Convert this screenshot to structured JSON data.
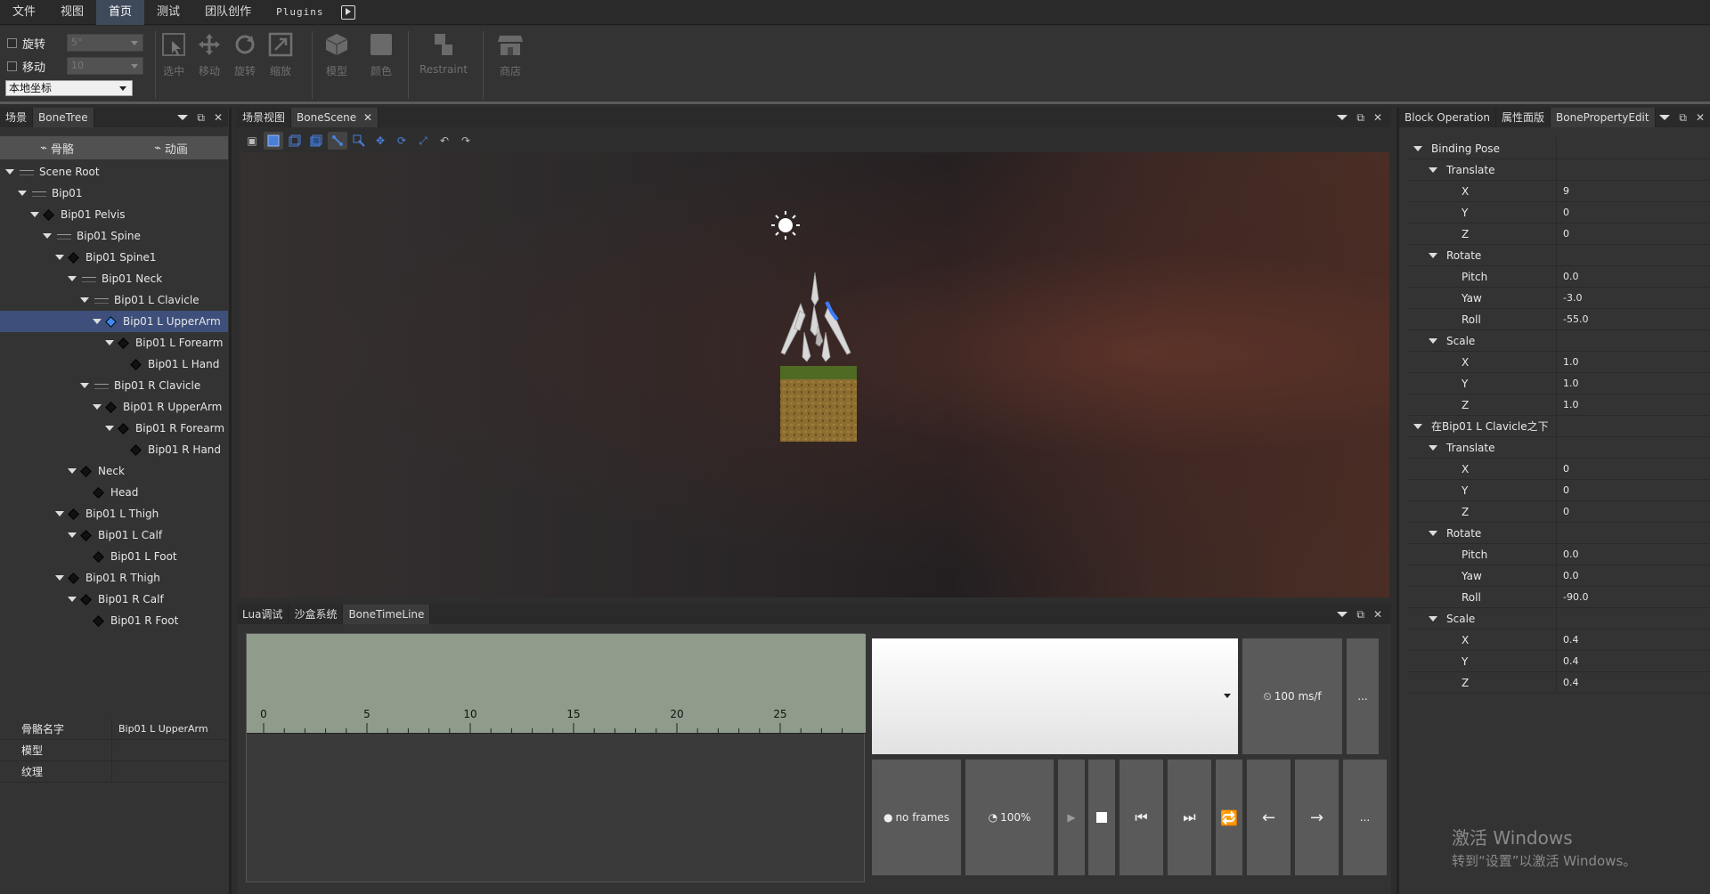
{
  "menu": [
    "文件",
    "视图",
    "首页",
    "测试",
    "团队创作",
    "Plugins"
  ],
  "toolbar": {
    "rotate_label": "旋转",
    "rotate_value": "5°",
    "move_label": "移动",
    "move_value": "10",
    "coord_value": "本地坐标",
    "buttons": [
      "选中",
      "移动",
      "旋转",
      "缩放",
      "模型",
      "颜色",
      "Restraint",
      "商店"
    ]
  },
  "left": {
    "tabs": [
      "场景",
      "BoneTree"
    ],
    "subtabs": [
      "骨骼",
      "动画"
    ],
    "tree": [
      {
        "label": "Scene Root",
        "level": 0,
        "icon": "bone-wave",
        "twisty": true
      },
      {
        "label": "Bip01",
        "level": 1,
        "icon": "bone-wave",
        "twisty": true
      },
      {
        "label": "Bip01 Pelvis",
        "level": 2,
        "icon": "diamond",
        "twisty": true
      },
      {
        "label": "Bip01 Spine",
        "level": 3,
        "icon": "bone-wave",
        "twisty": true
      },
      {
        "label": "Bip01 Spine1",
        "level": 4,
        "icon": "diamond",
        "twisty": true
      },
      {
        "label": "Bip01 Neck",
        "level": 5,
        "icon": "bone-wave",
        "twisty": true
      },
      {
        "label": "Bip01 L Clavicle",
        "level": 6,
        "icon": "bone-wave",
        "twisty": true
      },
      {
        "label": "Bip01 L UpperArm",
        "level": 7,
        "icon": "diamond",
        "twisty": true,
        "selected": true
      },
      {
        "label": "Bip01 L Forearm",
        "level": 8,
        "icon": "diamond",
        "twisty": true
      },
      {
        "label": "Bip01 L Hand",
        "level": 9,
        "icon": "diamond",
        "twisty": false
      },
      {
        "label": "Bip01 R Clavicle",
        "level": 6,
        "icon": "bone-wave",
        "twisty": true
      },
      {
        "label": "Bip01 R UpperArm",
        "level": 7,
        "icon": "diamond",
        "twisty": true
      },
      {
        "label": "Bip01 R Forearm",
        "level": 8,
        "icon": "diamond",
        "twisty": true
      },
      {
        "label": "Bip01 R Hand",
        "level": 9,
        "icon": "diamond",
        "twisty": false
      },
      {
        "label": "Neck",
        "level": 5,
        "icon": "diamond",
        "twisty": true
      },
      {
        "label": "Head",
        "level": 6,
        "icon": "diamond",
        "twisty": false
      },
      {
        "label": "Bip01 L Thigh",
        "level": 4,
        "icon": "diamond",
        "twisty": true
      },
      {
        "label": "Bip01 L Calf",
        "level": 5,
        "icon": "diamond",
        "twisty": true
      },
      {
        "label": "Bip01 L Foot",
        "level": 6,
        "icon": "diamond",
        "twisty": false
      },
      {
        "label": "Bip01 R Thigh",
        "level": 4,
        "icon": "diamond",
        "twisty": true
      },
      {
        "label": "Bip01 R Calf",
        "level": 5,
        "icon": "diamond",
        "twisty": true
      },
      {
        "label": "Bip01 R Foot",
        "level": 6,
        "icon": "diamond",
        "twisty": false
      }
    ],
    "props": [
      {
        "key": "骨骼名字",
        "value": "Bip01 L UpperArm"
      },
      {
        "key": "模型",
        "value": ""
      },
      {
        "key": "纹理",
        "value": ""
      }
    ]
  },
  "center": {
    "tabs": [
      "场景视图",
      "BoneScene"
    ]
  },
  "bottom": {
    "tabs": [
      "Lua调试",
      "沙盒系统",
      "BoneTimeLine"
    ],
    "ruler_ticks": [
      "0",
      "5",
      "10",
      "15",
      "20",
      "25"
    ],
    "speed": "100 ms/f",
    "frames": "no frames",
    "zoom": "100%",
    "more": "..."
  },
  "right": {
    "tabs": [
      "Block Operation",
      "属性面版",
      "BonePropertyEdit"
    ],
    "props": [
      {
        "label": "Binding Pose",
        "level": 0,
        "twisty": true,
        "value": ""
      },
      {
        "label": "Translate",
        "level": 1,
        "twisty": true,
        "value": ""
      },
      {
        "label": "X",
        "level": 2,
        "twisty": false,
        "value": "9"
      },
      {
        "label": "Y",
        "level": 2,
        "twisty": false,
        "value": "0"
      },
      {
        "label": "Z",
        "level": 2,
        "twisty": false,
        "value": "0"
      },
      {
        "label": "Rotate",
        "level": 1,
        "twisty": true,
        "value": ""
      },
      {
        "label": "Pitch",
        "level": 2,
        "twisty": false,
        "value": "0.0"
      },
      {
        "label": "Yaw",
        "level": 2,
        "twisty": false,
        "value": "-3.0"
      },
      {
        "label": "Roll",
        "level": 2,
        "twisty": false,
        "value": "-55.0"
      },
      {
        "label": "Scale",
        "level": 1,
        "twisty": true,
        "value": ""
      },
      {
        "label": "X",
        "level": 2,
        "twisty": false,
        "value": "1.0"
      },
      {
        "label": "Y",
        "level": 2,
        "twisty": false,
        "value": "1.0"
      },
      {
        "label": "Z",
        "level": 2,
        "twisty": false,
        "value": "1.0"
      },
      {
        "label": "在Bip01 L Clavicle之下",
        "level": 0,
        "twisty": true,
        "value": ""
      },
      {
        "label": "Translate",
        "level": 1,
        "twisty": true,
        "value": ""
      },
      {
        "label": "X",
        "level": 2,
        "twisty": false,
        "value": "0"
      },
      {
        "label": "Y",
        "level": 2,
        "twisty": false,
        "value": "0"
      },
      {
        "label": "Z",
        "level": 2,
        "twisty": false,
        "value": "0"
      },
      {
        "label": "Rotate",
        "level": 1,
        "twisty": true,
        "value": ""
      },
      {
        "label": "Pitch",
        "level": 2,
        "twisty": false,
        "value": "0.0"
      },
      {
        "label": "Yaw",
        "level": 2,
        "twisty": false,
        "value": "0.0"
      },
      {
        "label": "Roll",
        "level": 2,
        "twisty": false,
        "value": "-90.0"
      },
      {
        "label": "Scale",
        "level": 1,
        "twisty": true,
        "value": ""
      },
      {
        "label": "X",
        "level": 2,
        "twisty": false,
        "value": "0.4"
      },
      {
        "label": "Y",
        "level": 2,
        "twisty": false,
        "value": "0.4"
      },
      {
        "label": "Z",
        "level": 2,
        "twisty": false,
        "value": "0.4"
      }
    ]
  },
  "watermark": {
    "line1": "激活 Windows",
    "line2": "转到“设置”以激活 Windows。"
  }
}
